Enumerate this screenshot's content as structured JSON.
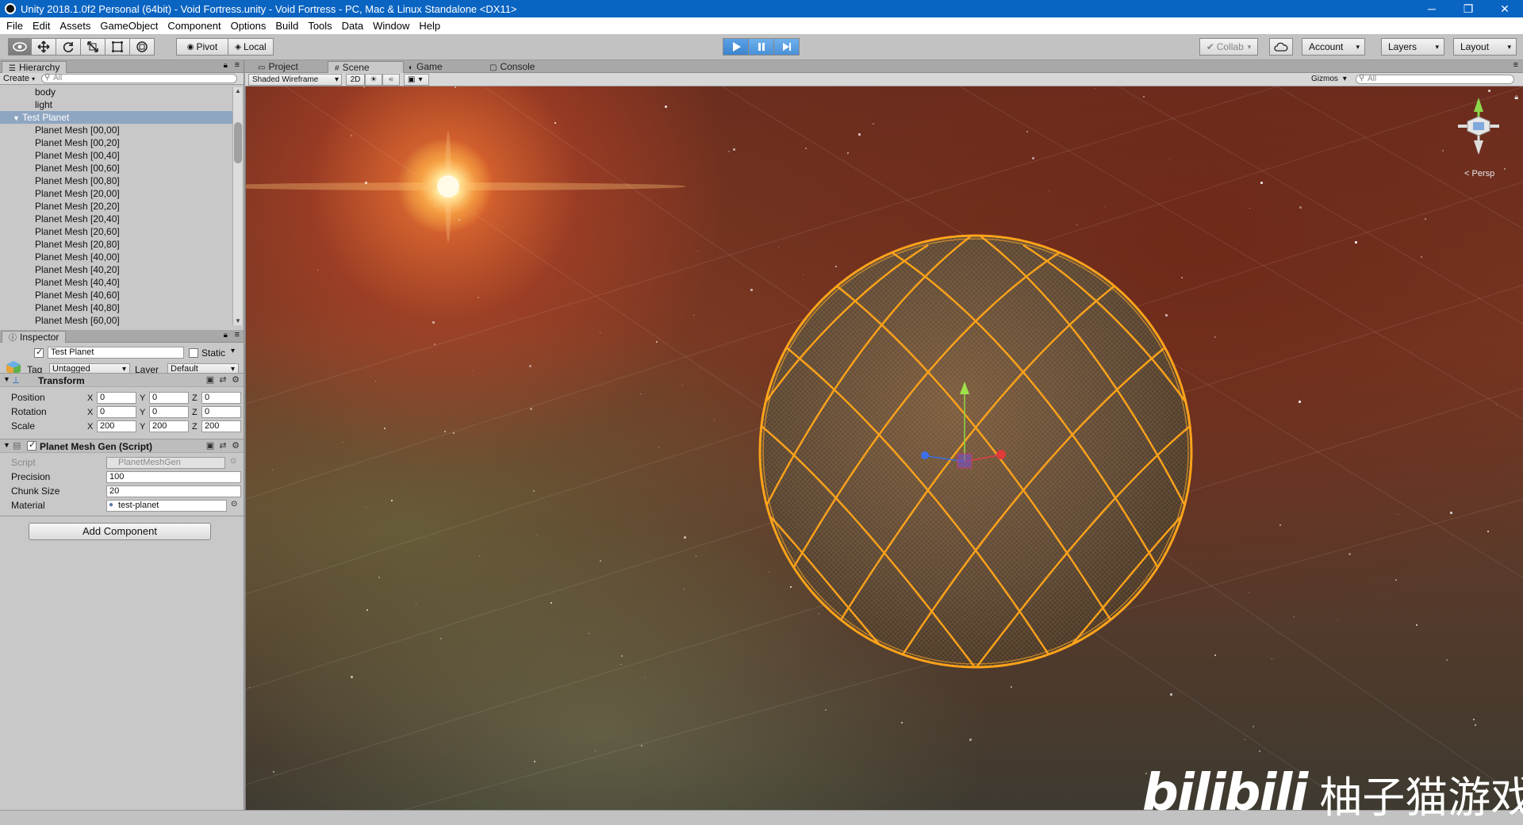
{
  "window": {
    "title": "Unity 2018.1.0f2 Personal (64bit) - Void Fortress.unity - Void Fortress - PC, Mac & Linux Standalone <DX11>",
    "minimize": "─",
    "restore": "❐",
    "close": "✕"
  },
  "menu": [
    "File",
    "Edit",
    "Assets",
    "GameObject",
    "Component",
    "Options",
    "Build",
    "Tools",
    "Data",
    "Window",
    "Help"
  ],
  "toolbar": {
    "pivot": "Pivot",
    "local": "Local",
    "collab": "Collab",
    "account": "Account",
    "layers": "Layers",
    "layout": "Layout"
  },
  "hierarchy": {
    "tab": "Hierarchy",
    "create": "Create",
    "search_placeholder": "All",
    "items": [
      {
        "label": "body",
        "indent": 2,
        "selected": false,
        "expand": false
      },
      {
        "label": "light",
        "indent": 2,
        "selected": false,
        "expand": false
      },
      {
        "label": "Test Planet",
        "indent": 1,
        "selected": true,
        "expand": true
      },
      {
        "label": "Planet Mesh [00,00]",
        "indent": 2,
        "selected": false,
        "expand": false
      },
      {
        "label": "Planet Mesh [00,20]",
        "indent": 2,
        "selected": false,
        "expand": false
      },
      {
        "label": "Planet Mesh [00,40]",
        "indent": 2,
        "selected": false,
        "expand": false
      },
      {
        "label": "Planet Mesh [00,60]",
        "indent": 2,
        "selected": false,
        "expand": false
      },
      {
        "label": "Planet Mesh [00,80]",
        "indent": 2,
        "selected": false,
        "expand": false
      },
      {
        "label": "Planet Mesh [20,00]",
        "indent": 2,
        "selected": false,
        "expand": false
      },
      {
        "label": "Planet Mesh [20,20]",
        "indent": 2,
        "selected": false,
        "expand": false
      },
      {
        "label": "Planet Mesh [20,40]",
        "indent": 2,
        "selected": false,
        "expand": false
      },
      {
        "label": "Planet Mesh [20,60]",
        "indent": 2,
        "selected": false,
        "expand": false
      },
      {
        "label": "Planet Mesh [20,80]",
        "indent": 2,
        "selected": false,
        "expand": false
      },
      {
        "label": "Planet Mesh [40,00]",
        "indent": 2,
        "selected": false,
        "expand": false
      },
      {
        "label": "Planet Mesh [40,20]",
        "indent": 2,
        "selected": false,
        "expand": false
      },
      {
        "label": "Planet Mesh [40,40]",
        "indent": 2,
        "selected": false,
        "expand": false
      },
      {
        "label": "Planet Mesh [40,60]",
        "indent": 2,
        "selected": false,
        "expand": false
      },
      {
        "label": "Planet Mesh [40,80]",
        "indent": 2,
        "selected": false,
        "expand": false
      },
      {
        "label": "Planet Mesh [60,00]",
        "indent": 2,
        "selected": false,
        "expand": false
      }
    ]
  },
  "inspector": {
    "tab": "Inspector",
    "object_name": "Test Planet",
    "static_label": "Static",
    "tag_label": "Tag",
    "tag_value": "Untagged",
    "layer_label": "Layer",
    "layer_value": "Default",
    "transform": {
      "title": "Transform",
      "position_label": "Position",
      "rotation_label": "Rotation",
      "scale_label": "Scale",
      "position": {
        "x": "0",
        "y": "0",
        "z": "0"
      },
      "rotation": {
        "x": "0",
        "y": "0",
        "z": "0"
      },
      "scale": {
        "x": "200",
        "y": "200",
        "z": "200"
      },
      "x": "X",
      "y": "Y",
      "z": "Z"
    },
    "script_component": {
      "title": "Planet Mesh Gen (Script)",
      "script_label": "Script",
      "script_value": "PlanetMeshGen",
      "precision_label": "Precision",
      "precision_value": "100",
      "chunk_label": "Chunk Size",
      "chunk_value": "20",
      "material_label": "Material",
      "material_value": "test-planet"
    },
    "add_component": "Add Component"
  },
  "scene": {
    "tabs": [
      {
        "label": "Project",
        "icon": "▭",
        "active": false
      },
      {
        "label": "Scene",
        "icon": "#",
        "active": true
      },
      {
        "label": "Game",
        "icon": "◐",
        "active": false
      },
      {
        "label": "Console",
        "icon": "▢",
        "active": false
      }
    ],
    "shading": "Shaded Wireframe",
    "mode_2d": "2D",
    "gizmos": "Gizmos",
    "search_placeholder": "All",
    "persp": "Persp"
  },
  "watermark": {
    "logo": "bilibili",
    "text": "柚子猫游戏"
  },
  "colors": {
    "wire": "#ffa31a",
    "titlebar": "#0a64c2",
    "selection": "#8fa6c2",
    "play_active": "#3d84cf"
  }
}
